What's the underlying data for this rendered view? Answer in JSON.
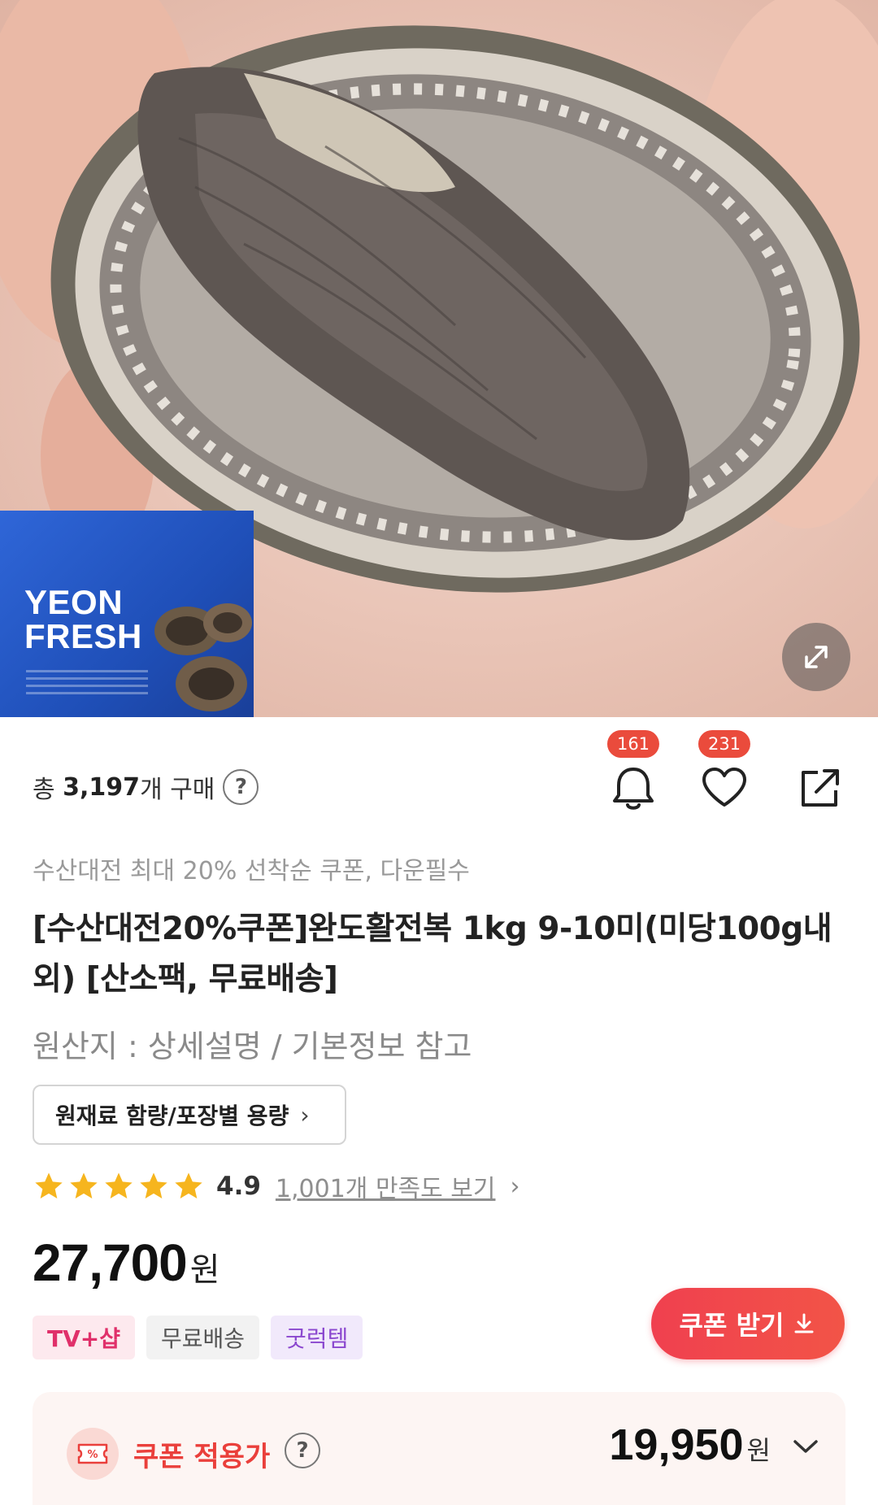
{
  "hero": {
    "pack_brand": "YEON\nFRESH"
  },
  "stats": {
    "purchase_prefix": "총",
    "purchase_count": "3,197",
    "purchase_suffix": "개 구매",
    "help": "?"
  },
  "actions": {
    "alert_count": "161",
    "wish_count": "231"
  },
  "product": {
    "promo_line": "수산대전 최대 20% 선착순 쿠폰, 다운필수",
    "title": "[수산대전20%쿠폰]완도활전복 1kg 9-10미(미당100g내외) [산소팩, 무료배송]",
    "origin": "원산지 : 상세설명 / 기본정보 참고",
    "ingredient_button": "원재료 함량/포장별 용량",
    "ingredient_chevron": "›"
  },
  "rating": {
    "score": "4.9",
    "review_link": "1,001개 만족도 보기",
    "chevron": "›",
    "stars_filled": 5
  },
  "price": {
    "amount": "27,700",
    "unit": "원"
  },
  "tags": [
    "TV+샵",
    "무료배송",
    "굿럭템"
  ],
  "coupon_button": {
    "label": "쿠폰 받기"
  },
  "coupon_panel": {
    "icon_text": "%",
    "label": "쿠폰 적용가",
    "help": "?",
    "amount": "19,950",
    "unit": "원"
  },
  "colors": {
    "accent": "#ea4b3c",
    "star": "#f6b51e",
    "tag_tv": "#e0306a",
    "tag_good": "#8b48cf"
  }
}
